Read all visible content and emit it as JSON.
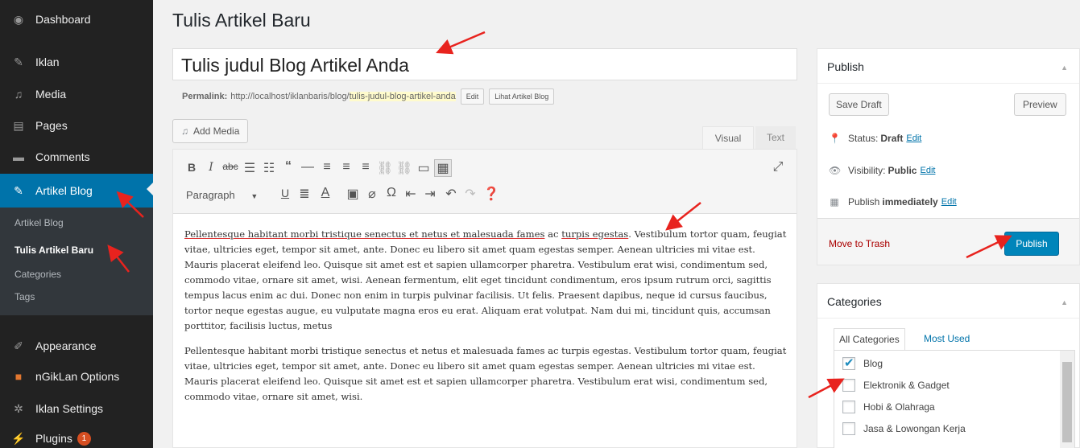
{
  "sidebar": {
    "items": [
      {
        "label": "Dashboard",
        "icon": "dashboard-icon"
      },
      {
        "label": "Iklan",
        "icon": "pin-icon"
      },
      {
        "label": "Media",
        "icon": "media-icon"
      },
      {
        "label": "Pages",
        "icon": "pages-icon"
      },
      {
        "label": "Comments",
        "icon": "comments-icon"
      },
      {
        "label": "Artikel Blog",
        "icon": "pin-icon"
      },
      {
        "label": "Appearance",
        "icon": "appearance-icon"
      },
      {
        "label": "nGikLan Options",
        "icon": "options-icon"
      },
      {
        "label": "Iklan Settings",
        "icon": "settings-icon"
      },
      {
        "label": "Plugins",
        "icon": "plugins-icon",
        "badge": "1"
      }
    ],
    "submenu": [
      "Artikel Blog",
      "Tulis Artikel Baru",
      "Categories",
      "Tags"
    ]
  },
  "main": {
    "page_title": "Tulis Artikel Baru",
    "post_title": "Tulis judul Blog Artikel Anda",
    "permalink": {
      "label": "Permalink:",
      "base": "http://localhost/iklanbaris/blog/",
      "slug": "tulis-judul-blog-artikel-anda",
      "edit": "Edit",
      "view": "Lihat Artikel Blog"
    },
    "add_media": "Add Media",
    "tabs": {
      "visual": "Visual",
      "text": "Text"
    },
    "format": "Paragraph",
    "content": {
      "p1_spell": "Pellentesque habitant morbi tristique senectus et netus et malesuada fames",
      "p1_mid": " ac ",
      "p1_spell2": "turpis egestas",
      "p1_rest": ". Vestibulum tortor quam, feugiat vitae, ultricies eget, tempor sit amet, ante. Donec eu libero sit amet quam egestas semper. Aenean ultricies mi vitae est. Mauris placerat eleifend leo. Quisque sit amet est et sapien ullamcorper pharetra. Vestibulum erat wisi, condimentum sed, commodo vitae, ornare sit amet, wisi. Aenean fermentum, elit eget tincidunt condimentum, eros ipsum rutrum orci, sagittis tempus lacus enim ac dui. Donec non enim in turpis pulvinar facilisis. Ut felis. Praesent dapibus, neque id cursus faucibus, tortor neque egestas augue, eu vulputate magna eros eu erat. Aliquam erat volutpat. Nam dui mi, tincidunt quis, accumsan porttitor, facilisis luctus, metus",
      "p2": "Pellentesque habitant morbi tristique senectus et netus et malesuada fames ac turpis egestas. Vestibulum tortor quam, feugiat vitae, ultricies eget, tempor sit amet, ante. Donec eu libero sit amet quam egestas semper. Aenean ultricies mi vitae est. Mauris placerat eleifend leo. Quisque sit amet est et sapien ullamcorper pharetra. Vestibulum erat wisi, condimentum sed, commodo vitae, ornare sit amet, wisi."
    }
  },
  "publish": {
    "title": "Publish",
    "save_draft": "Save Draft",
    "preview": "Preview",
    "status_label": "Status:",
    "status_value": "Draft",
    "visibility_label": "Visibility:",
    "visibility_value": "Public",
    "schedule_label": "Publish",
    "schedule_value": "immediately",
    "edit": "Edit",
    "move_to_trash": "Move to Trash",
    "publish_button": "Publish"
  },
  "categories": {
    "title": "Categories",
    "tab_all": "All Categories",
    "tab_used": "Most Used",
    "items": [
      {
        "label": "Blog",
        "checked": true
      },
      {
        "label": "Elektronik & Gadget",
        "checked": false
      },
      {
        "label": "Hobi & Olahraga",
        "checked": false
      },
      {
        "label": "Jasa & Lowongan Kerja",
        "checked": false
      }
    ]
  },
  "colors": {
    "accent": "#0073aa",
    "publish": "#0085ba",
    "annotation": "#e8231e",
    "sidebar": "#222222"
  }
}
